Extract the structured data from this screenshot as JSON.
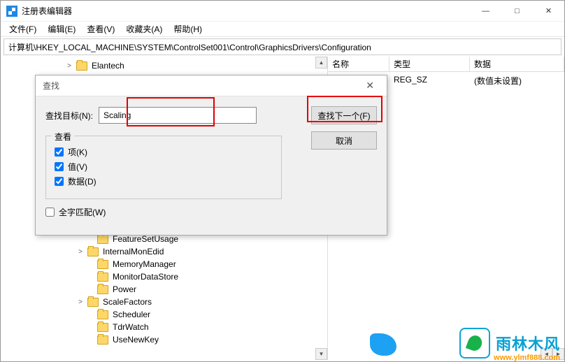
{
  "window": {
    "title": "注册表编辑器"
  },
  "menu": {
    "file": "文件(F)",
    "edit": "编辑(E)",
    "view": "查看(V)",
    "favorites": "收藏夹(A)",
    "help": "帮助(H)"
  },
  "address": "计算机\\HKEY_LOCAL_MACHINE\\SYSTEM\\ControlSet001\\Control\\GraphicsDrivers\\Configuration",
  "columns": {
    "name": "名称",
    "type": "类型",
    "data": "数据"
  },
  "list_row": {
    "name": "",
    "type": "REG_SZ",
    "data": "(数值未设置)"
  },
  "tree": {
    "top": [
      {
        "label": "Elantech",
        "expand": ">",
        "indent": 88
      }
    ],
    "bottom": [
      {
        "label": "FeatureSetUsage",
        "expand": "",
        "indent": 118
      },
      {
        "label": "InternalMonEdid",
        "expand": ">",
        "indent": 104
      },
      {
        "label": "MemoryManager",
        "expand": "",
        "indent": 118
      },
      {
        "label": "MonitorDataStore",
        "expand": "",
        "indent": 118
      },
      {
        "label": "Power",
        "expand": "",
        "indent": 118
      },
      {
        "label": "ScaleFactors",
        "expand": ">",
        "indent": 104
      },
      {
        "label": "Scheduler",
        "expand": "",
        "indent": 118
      },
      {
        "label": "TdrWatch",
        "expand": "",
        "indent": 118
      },
      {
        "label": "UseNewKey",
        "expand": "",
        "indent": 118
      }
    ]
  },
  "dialog": {
    "title": "查找",
    "label": "查找目标(N):",
    "value": "Scaling",
    "findnext": "查找下一个(F)",
    "cancel": "取消",
    "group": "查看",
    "chk_key": "项(K)",
    "chk_val": "值(V)",
    "chk_dat": "数据(D)",
    "fullmatch": "全字匹配(W)"
  },
  "watermark": {
    "text": "雨林木风",
    "url": "www.ylmf888.com"
  }
}
